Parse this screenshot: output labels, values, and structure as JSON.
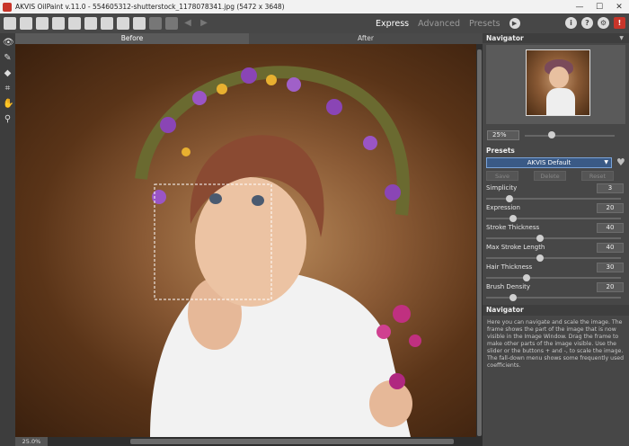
{
  "window": {
    "title": "AKVIS OilPaint v.11.0 - 554605312-shutterstock_1178078341.jpg (5472 x 3648)",
    "controls": [
      "—",
      "☐",
      "✕"
    ]
  },
  "toolbar": {
    "modes": {
      "express": "Express",
      "advanced": "Advanced",
      "presets": "Presets"
    },
    "icons": [
      "home-icon",
      "open-icon",
      "save-icon",
      "print-icon",
      "batch-icon",
      "share-icon",
      "brush-icon",
      "settings-icon",
      "plugin-icon",
      "disabled-icon",
      "undo-icon",
      "redo-icon"
    ]
  },
  "tabs": {
    "before": "Before",
    "after": "After"
  },
  "status": {
    "zoom": "25.0%"
  },
  "navigator": {
    "title": "Navigator",
    "zoom_value": "25%",
    "zoom_slider_fraction": 0.3
  },
  "presets": {
    "title": "Presets",
    "selected": "AKVIS Default",
    "buttons": {
      "save": "Save",
      "delete": "Delete",
      "reset": "Reset"
    }
  },
  "parameters": [
    {
      "label": "Simplicity",
      "value": "3",
      "fraction": 0.17
    },
    {
      "label": "Expression",
      "value": "20",
      "fraction": 0.2
    },
    {
      "label": "Stroke Thickness",
      "value": "40",
      "fraction": 0.4
    },
    {
      "label": "Max Stroke Length",
      "value": "40",
      "fraction": 0.4
    },
    {
      "label": "Hair Thickness",
      "value": "30",
      "fraction": 0.3
    },
    {
      "label": "Brush Density",
      "value": "20",
      "fraction": 0.2
    }
  ],
  "help": {
    "title": "Navigator",
    "text": "Here you can navigate and scale the image. The frame shows the part of the image that is now visible in the Image Window. Drag the frame to make other parts of the image visible. Use the slider or the buttons + and -, to scale the image. The fall-down menu shows some frequently used coefficients."
  }
}
